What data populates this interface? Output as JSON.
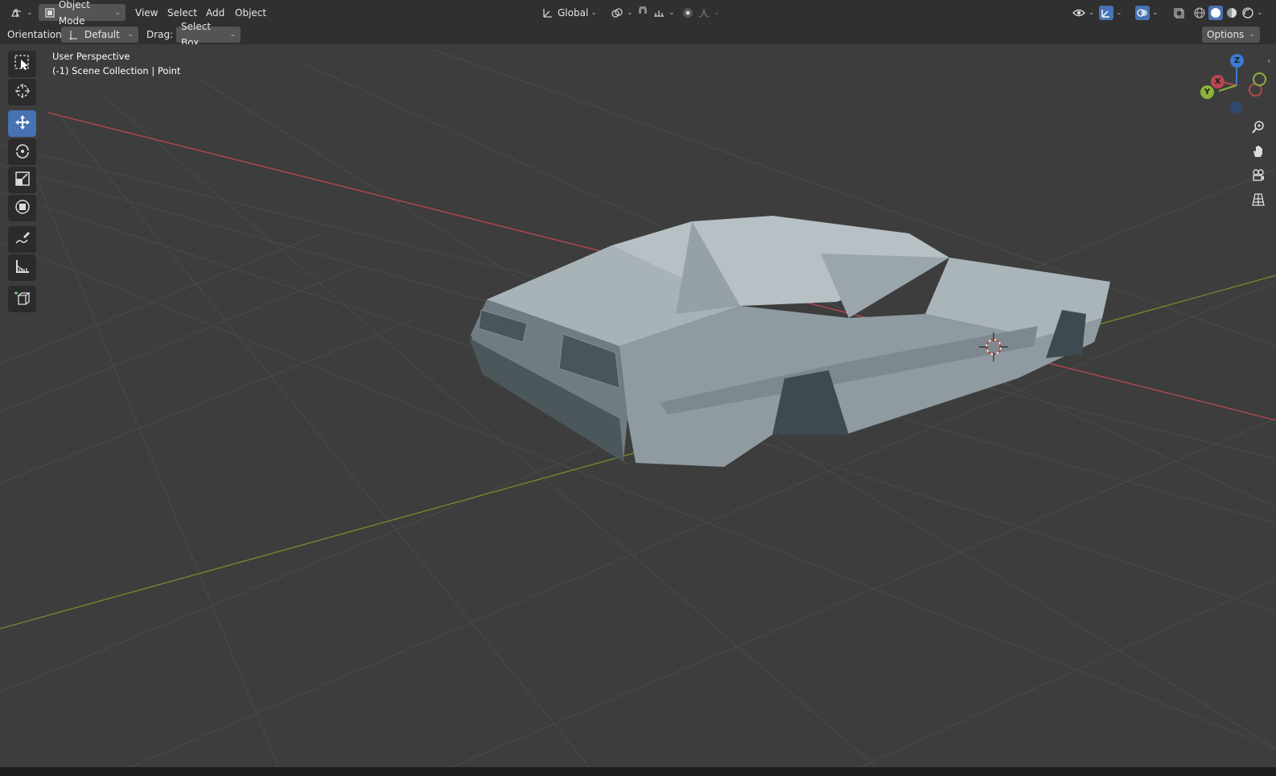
{
  "header": {
    "editor_type_icon": "editor-type-icon",
    "mode": "Object Mode",
    "menus": [
      "View",
      "Select",
      "Add",
      "Object"
    ],
    "transform_orientation": "Global",
    "pivot_icon": "pivot-point-icon",
    "snap_icon": "snap-magnet-icon",
    "snap_target_icon": "snap-increment-icon",
    "proportional_icon": "proportional-edit-icon",
    "falloff_icon": "falloff-curve-icon",
    "visibility_icon": "eye-icon",
    "gizmo_icon": "gizmo-icon",
    "overlay_icon": "overlay-icon",
    "xray_icon": "xray-icon",
    "shading_modes": [
      "wireframe-icon",
      "solid-icon",
      "material-icon",
      "rendered-icon"
    ],
    "active_shading": "solid-icon"
  },
  "subheader": {
    "orientation_label": "Orientation:",
    "orientation_value": "Default",
    "drag_label": "Drag:",
    "drag_value": "Select Box",
    "options_label": "Options"
  },
  "viewport": {
    "view_name": "User Perspective",
    "collection_info": "(-1) Scene Collection | Point"
  },
  "tools": [
    {
      "name": "select-box",
      "icon": "select-box-icon",
      "active": false
    },
    {
      "name": "cursor",
      "icon": "cursor-icon",
      "active": false
    },
    {
      "name": "move",
      "icon": "move-icon",
      "active": true
    },
    {
      "name": "rotate",
      "icon": "rotate-icon",
      "active": false
    },
    {
      "name": "scale",
      "icon": "scale-icon",
      "active": false
    },
    {
      "name": "transform",
      "icon": "transform-icon",
      "active": false
    },
    {
      "name": "annotate",
      "icon": "annotate-icon",
      "active": false
    },
    {
      "name": "measure",
      "icon": "measure-icon",
      "active": false
    },
    {
      "name": "add-cube",
      "icon": "add-cube-icon",
      "active": false
    }
  ],
  "gizmo": {
    "x_label": "X",
    "y_label": "Y",
    "z_label": "Z"
  },
  "nav_buttons": [
    "zoom-icon",
    "pan-hand-icon",
    "camera-icon",
    "grid-perspective-icon"
  ],
  "colors": {
    "x_axis": "#b8474f",
    "y_axis": "#6e8e2a",
    "active_tool": "#4772b3",
    "viewport_bg": "#3d3d3d"
  }
}
